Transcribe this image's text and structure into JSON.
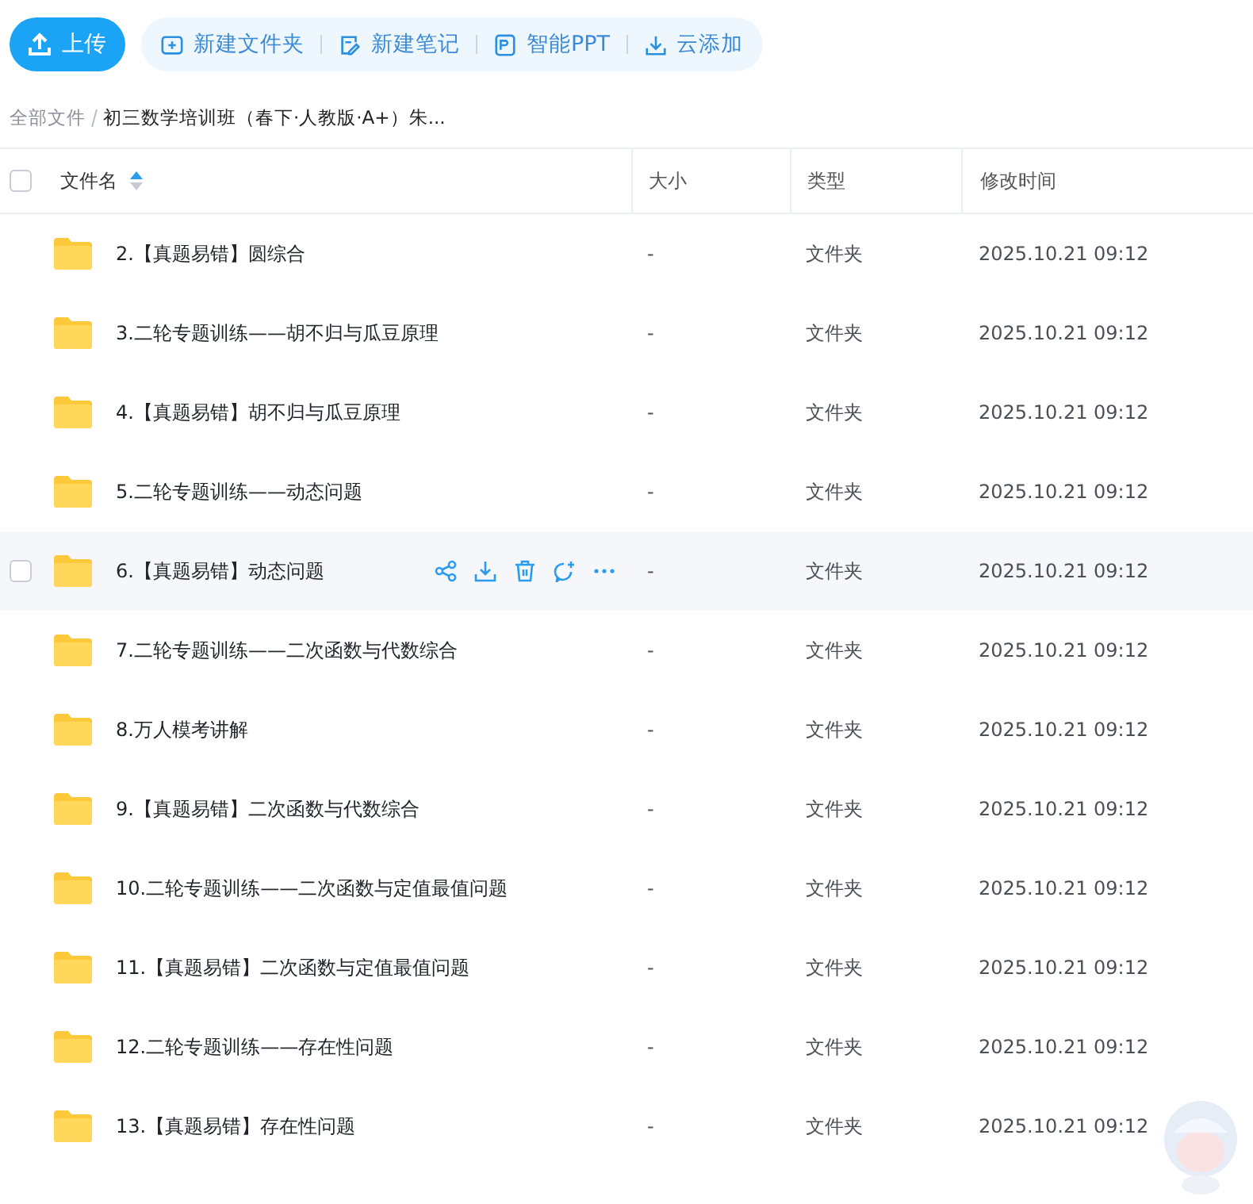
{
  "toolbar": {
    "upload": "上传",
    "actions": [
      {
        "kind": "folder",
        "label": "新建文件夹"
      },
      {
        "kind": "note",
        "label": "新建笔记"
      },
      {
        "kind": "ppt",
        "label": "智能PPT"
      },
      {
        "kind": "download",
        "label": "云添加"
      }
    ]
  },
  "breadcrumb": [
    {
      "label": "全部文件",
      "current": false
    },
    {
      "label": "初三数学培训班（春下·人教版·A+）朱...",
      "current": true
    }
  ],
  "table": {
    "select_all_checked": false,
    "columns": [
      {
        "label": "文件名",
        "sorted": true
      },
      {
        "label": "大小",
        "sorted": false
      },
      {
        "label": "类型",
        "sorted": false
      },
      {
        "label": "修改时间",
        "sorted": false
      }
    ],
    "rows": [
      {
        "name": "2.【真题易错】圆综合",
        "size": "-",
        "type": "文件夹",
        "modified": "2025.10.21 09:12",
        "hovered": false
      },
      {
        "name": "3.二轮专题训练——胡不归与瓜豆原理",
        "size": "-",
        "type": "文件夹",
        "modified": "2025.10.21 09:12",
        "hovered": false
      },
      {
        "name": "4.【真题易错】胡不归与瓜豆原理",
        "size": "-",
        "type": "文件夹",
        "modified": "2025.10.21 09:12",
        "hovered": false
      },
      {
        "name": "5.二轮专题训练——动态问题",
        "size": "-",
        "type": "文件夹",
        "modified": "2025.10.21 09:12",
        "hovered": false
      },
      {
        "name": "6.【真题易错】动态问题",
        "size": "-",
        "type": "文件夹",
        "modified": "2025.10.21 09:12",
        "hovered": true,
        "checked": false
      },
      {
        "name": "7.二轮专题训练——二次函数与代数综合",
        "size": "-",
        "type": "文件夹",
        "modified": "2025.10.21 09:12",
        "hovered": false
      },
      {
        "name": "8.万人模考讲解",
        "size": "-",
        "type": "文件夹",
        "modified": "2025.10.21 09:12",
        "hovered": false
      },
      {
        "name": "9.【真题易错】二次函数与代数综合",
        "size": "-",
        "type": "文件夹",
        "modified": "2025.10.21 09:12",
        "hovered": false
      },
      {
        "name": "10.二轮专题训练——二次函数与定值最值问题",
        "size": "-",
        "type": "文件夹",
        "modified": "2025.10.21 09:12",
        "hovered": false
      },
      {
        "name": "11.【真题易错】二次函数与定值最值问题",
        "size": "-",
        "type": "文件夹",
        "modified": "2025.10.21 09:12",
        "hovered": false
      },
      {
        "name": "12.二轮专题训练——存在性问题",
        "size": "-",
        "type": "文件夹",
        "modified": "2025.10.21 09:12",
        "hovered": false
      },
      {
        "name": "13.【真题易错】存在性问题",
        "size": "-",
        "type": "文件夹",
        "modified": "2025.10.21 09:12",
        "hovered": false
      }
    ]
  }
}
